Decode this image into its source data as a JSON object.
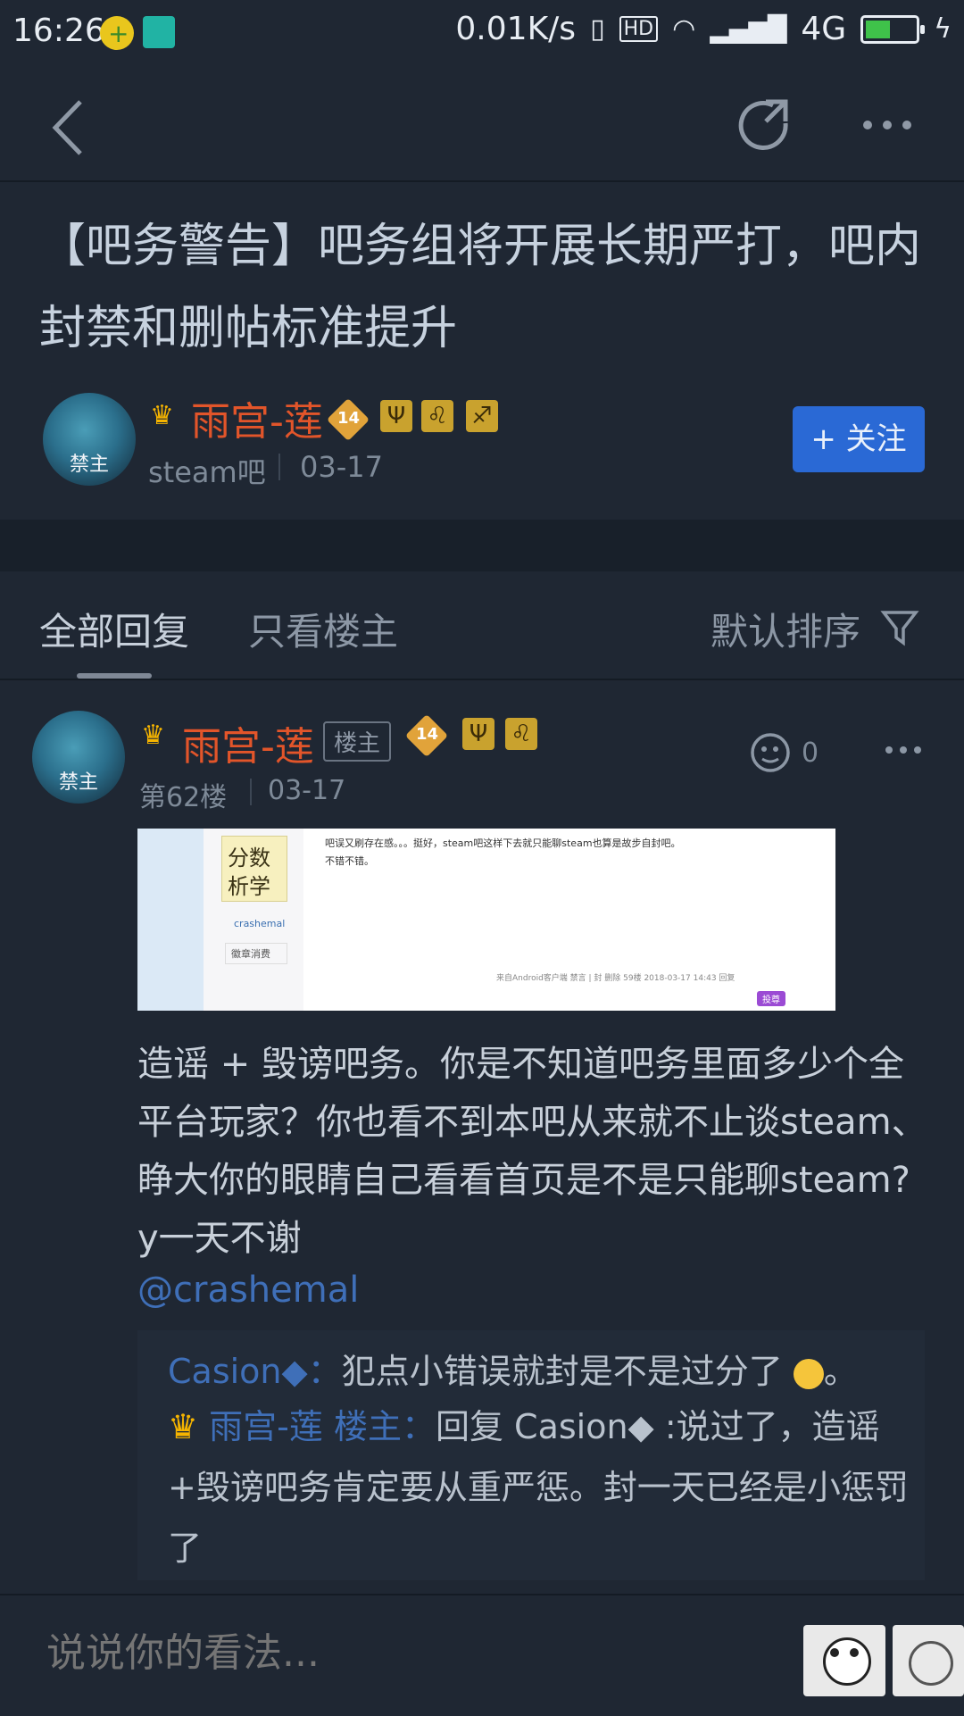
{
  "status_bar": {
    "time": "16:26",
    "network_speed": "0.01K/s",
    "hd_label": "HD",
    "network_type": "4G",
    "battery_level": 0.45
  },
  "nav": {
    "back_icon": "chevron-left-icon",
    "refresh_icon": "refresh-icon",
    "more_icon": "more-icon"
  },
  "post": {
    "title": "【吧务警告】吧务组将开展长期严打，吧内封禁和删帖标准提升",
    "author": {
      "name": "雨宫-莲",
      "level": "14",
      "avatar_tag": "禁主",
      "forum": "steam吧",
      "date": "03-17"
    },
    "follow_label": "+ 关注"
  },
  "tabs": {
    "all_replies": "全部回复",
    "only_op": "只看楼主",
    "sort": "默认排序"
  },
  "reply": {
    "author_name": "雨宫-莲",
    "op_badge": "楼主",
    "level": "14",
    "floor": "第62楼",
    "date": "03-17",
    "like_count": "0",
    "screenshot": {
      "book_title_1": "分数",
      "book_title_2": "析学",
      "quoted_text": "吧误又刷存在感。。。挺好，steam吧这样下去就只能聊steam也算是故步自封吧。",
      "quoted_text_2": "不错不错。",
      "username": "crashemal",
      "medal": "徽章消费",
      "footer": "来自Android客户端 禁言 | 封 删除 59楼 2018-03-17 14:43 回复",
      "corner_tag": "投尊"
    },
    "body": "造谣 + 毁谤吧务。你是不知道吧务里面多少个全平台玩家？你也看不到本吧从来就不止谈steam、睁大你的眼睛自己看看首页是不是只能聊steam? y一天不谢",
    "mention": "@crashemal",
    "quotes": [
      {
        "name": "Casion◆：",
        "text": "犯点小错误就封是不是过分了"
      },
      {
        "name": "雨宫-莲 楼主：",
        "text": "回复 Casion◆ :说过了，造谣+毁谤吧务肯定要从重严惩。封一天已经是小惩罚了"
      }
    ],
    "quote_end": "。"
  },
  "bottom": {
    "comment_placeholder": "说说你的看法..."
  }
}
